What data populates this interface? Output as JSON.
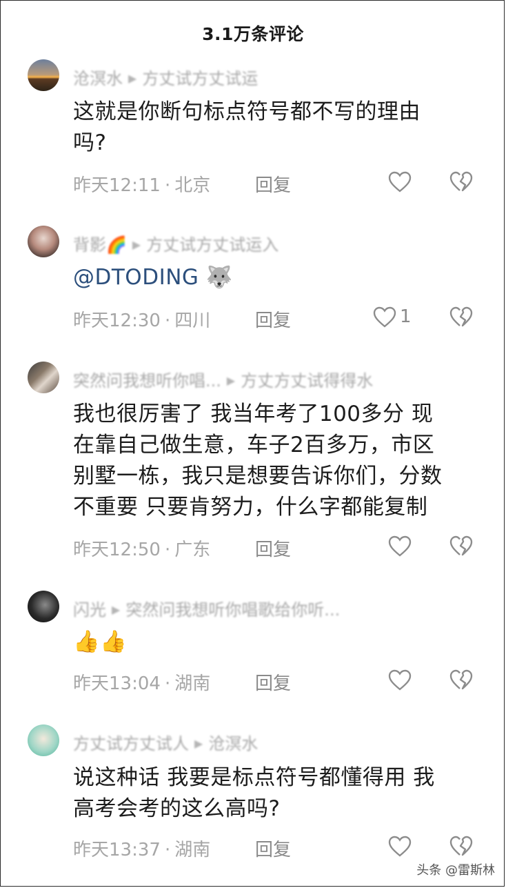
{
  "header": {
    "title": "3.1万条评论"
  },
  "comments": [
    {
      "user": "沧溟水",
      "reply_to": "方丈试方丈试运",
      "text_lines": [
        "这就是你断句标点符号都不写的理由",
        "吗?"
      ],
      "time": "昨天12:11",
      "location": "北京",
      "reply_label": "回复",
      "like_count": ""
    },
    {
      "user": "背影🌈",
      "reply_to": "方丈试方丈试运入",
      "text_lines": [
        "@DTODING 🐺"
      ],
      "time": "昨天12:30",
      "location": "四川",
      "reply_label": "回复",
      "like_count": "1"
    },
    {
      "user": "突然问我想听你唱...",
      "reply_to": "方丈方丈试得得水",
      "text_lines": [
        "我也很厉害了 我当年考了100多分 现",
        "在靠自己做生意，车子2百多万，市区",
        "别墅一栋，我只是想要告诉你们，分数",
        "不重要 只要肯努力，什么字都能复制"
      ],
      "time": "昨天12:50",
      "location": "广东",
      "reply_label": "回复",
      "like_count": ""
    },
    {
      "user": "闪光",
      "reply_to": "突然问我想听你唱歌给你听...",
      "text_lines": [
        "👍👍"
      ],
      "time": "昨天13:04",
      "location": "湖南",
      "reply_label": "回复",
      "like_count": ""
    },
    {
      "user": "方丈试方丈试人",
      "reply_to": "沧溟水",
      "text_lines": [
        "说这种话 我要是标点符号都懂得用 我",
        "高考会考的这么高吗?"
      ],
      "time": "昨天13:37",
      "location": "湖南",
      "reply_label": "回复",
      "like_count": ""
    }
  ],
  "icons": {
    "like": "heart-outline-icon",
    "dislike": "broken-heart-icon",
    "reply_arrow": "triangle-right-icon"
  },
  "watermark": "头条 @雷斯林"
}
